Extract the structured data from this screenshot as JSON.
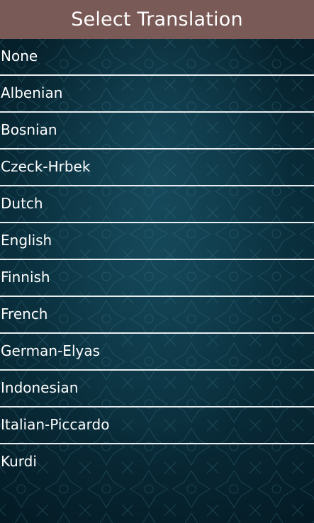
{
  "header": {
    "title": "Select Translation"
  },
  "translations": [
    {
      "label": "None"
    },
    {
      "label": "Albenian"
    },
    {
      "label": "Bosnian"
    },
    {
      "label": "Czeck-Hrbek"
    },
    {
      "label": "Dutch"
    },
    {
      "label": "English"
    },
    {
      "label": "Finnish"
    },
    {
      "label": "French"
    },
    {
      "label": "German-Elyas"
    },
    {
      "label": "Indonesian"
    },
    {
      "label": "Italian-Piccardo"
    },
    {
      "label": "Kurdi"
    }
  ],
  "colors": {
    "header_background": "#7a5a57",
    "background": "#0a2f3d",
    "divider": "#e8eef0",
    "text": "#ffffff"
  }
}
